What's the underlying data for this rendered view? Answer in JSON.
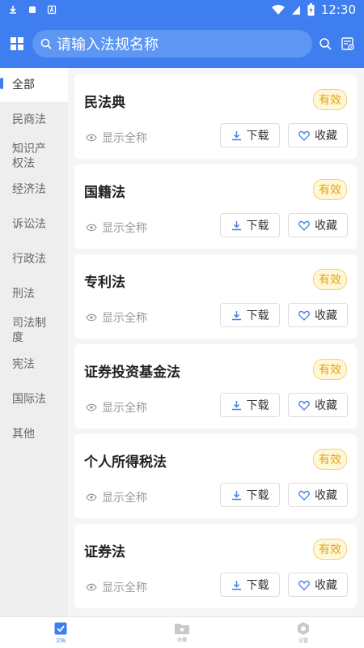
{
  "statusbar": {
    "time": "12:30"
  },
  "search": {
    "placeholder": "请输入法规名称"
  },
  "sidebar": {
    "items": [
      {
        "label": "全部",
        "active": true
      },
      {
        "label": "民商法"
      },
      {
        "label": "知识产权法"
      },
      {
        "label": "经济法"
      },
      {
        "label": "诉讼法"
      },
      {
        "label": "行政法"
      },
      {
        "label": "刑法"
      },
      {
        "label": "司法制度"
      },
      {
        "label": "宪法"
      },
      {
        "label": "国际法"
      },
      {
        "label": "其他"
      }
    ]
  },
  "cards": [
    {
      "title": "民法典",
      "status": "有效",
      "fullname_label": "显示全称",
      "download_label": "下载",
      "favorite_label": "收藏"
    },
    {
      "title": "国籍法",
      "status": "有效",
      "fullname_label": "显示全称",
      "download_label": "下载",
      "favorite_label": "收藏"
    },
    {
      "title": "专利法",
      "status": "有效",
      "fullname_label": "显示全称",
      "download_label": "下载",
      "favorite_label": "收藏"
    },
    {
      "title": "证券投资基金法",
      "status": "有效",
      "fullname_label": "显示全称",
      "download_label": "下载",
      "favorite_label": "收藏"
    },
    {
      "title": "个人所得税法",
      "status": "有效",
      "fullname_label": "显示全称",
      "download_label": "下载",
      "favorite_label": "收藏"
    },
    {
      "title": "证券法",
      "status": "有效",
      "fullname_label": "显示全称",
      "download_label": "下载",
      "favorite_label": "收藏"
    }
  ],
  "bottomnav": {
    "items": [
      {
        "label": "文档",
        "icon": "document-icon",
        "active": true
      },
      {
        "label": "收藏",
        "icon": "folder-star-icon"
      },
      {
        "label": "设置",
        "icon": "settings-icon"
      }
    ]
  },
  "colors": {
    "primary": "#3f7ef0",
    "badge_text": "#e0a419",
    "badge_bg": "#fff7d6"
  }
}
